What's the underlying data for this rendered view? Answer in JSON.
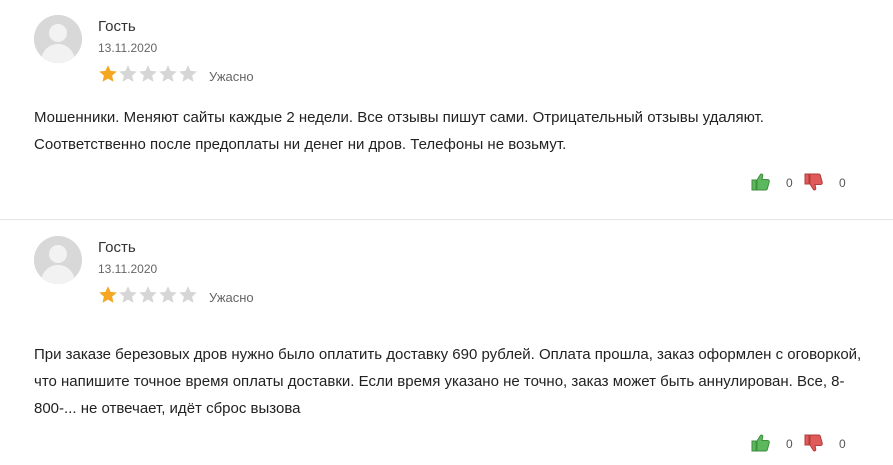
{
  "reviews": [
    {
      "author": "Гость",
      "date": "13.11.2020",
      "rating": 1,
      "rating_max": 5,
      "rating_label": "Ужасно",
      "text": "Мошенники. Меняют сайты каждые 2 недели. Все отзывы пишут сами. Отрицательный отзывы удаляют. Соответственно после предоплаты ни денег ни дров. Телефоны не возьмут.",
      "likes": "0",
      "dislikes": "0"
    },
    {
      "author": "Гость",
      "date": "13.11.2020",
      "rating": 1,
      "rating_max": 5,
      "rating_label": "Ужасно",
      "text": "При заказе березовых дров нужно было оплатить доставку 690 рублей. Оплата прошла, заказ оформлен с оговоркой, что напишите точное время оплаты доставки. Если время указано не точно, заказ может быть аннулирован. Все, 8-800-... не отвечает, идёт сброс вызова",
      "likes": "0",
      "dislikes": "0"
    }
  ],
  "colors": {
    "star_filled": "#f5a623",
    "star_empty": "#d6d6d6",
    "thumb_up": "#5cb85c",
    "thumb_down": "#e05a5a",
    "avatar_bg": "#d8d8d8",
    "avatar_fg": "#f2f2f2"
  },
  "icons": {
    "avatar": "user-silhouette-icon",
    "star": "star-icon",
    "like": "thumbs-up-icon",
    "dislike": "thumbs-down-icon"
  }
}
